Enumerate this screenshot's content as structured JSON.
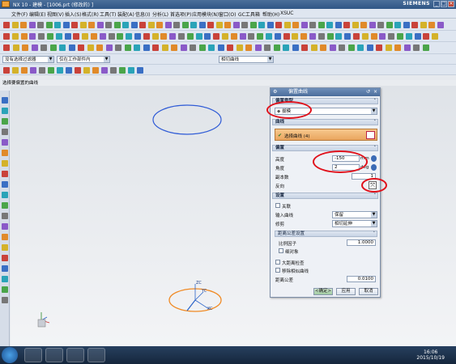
{
  "window": {
    "title": "NX 10 - 建模 - [1006.prt (修改的) ]",
    "brand": "SIEMENS"
  },
  "menubar": {
    "items": [
      "文件(F)",
      "编辑(E)",
      "视图(V)",
      "插入(S)",
      "格式(R)",
      "工具(T)",
      "装配(A)",
      "信息(I)",
      "分析(L)",
      "首选项(P)",
      "应用模块(N)",
      "窗口(O)",
      "GC工具箱",
      "帮助(H)",
      "XSUC"
    ]
  },
  "selectionbar": {
    "filter": "没有选择过滤器",
    "scope": "仅在工作部件内",
    "curve_rule": "相切曲线"
  },
  "cue_line": "选择要偏置的曲线",
  "dialog": {
    "title": "偏置曲线",
    "type_section": "偏置类型",
    "type_value": "拔模",
    "curve_section": "曲线",
    "curve_select_label": "选择曲线 (4)",
    "offset_section": "偏置",
    "height_label": "高度",
    "height_value": "-150",
    "height_unit": "mm",
    "angle_label": "角度",
    "angle_value": "2",
    "angle_unit": "deg",
    "copies_label": "副本数",
    "copies_value": "1",
    "reverse_label": "反向",
    "settings_section": "设置",
    "associative_label": "关联",
    "input_curve_label": "输入曲线",
    "input_curve_value": "保留",
    "trim_label": "修剪",
    "trim_value": "相切延伸",
    "distance_section": "距离公差设置",
    "scale_label": "比例因子",
    "scale_value": "1.0000",
    "sub_label": "细对象",
    "max_check_label": "大距离检查",
    "remove_label": "移除相似曲线",
    "tolerance_label": "距离公差",
    "tolerance_value": "0.0100",
    "ok": "<确定>",
    "apply": "应用",
    "cancel": "取消"
  },
  "triad": {
    "zc": "ZC",
    "yc": "YC",
    "xc": "XC"
  },
  "taskbar": {
    "time": "16:06",
    "date": "2015/10/19"
  },
  "colors": {
    "circle": "#2f5bd6",
    "draft_curve": "#f08a24",
    "highlight": "#e0101a"
  }
}
